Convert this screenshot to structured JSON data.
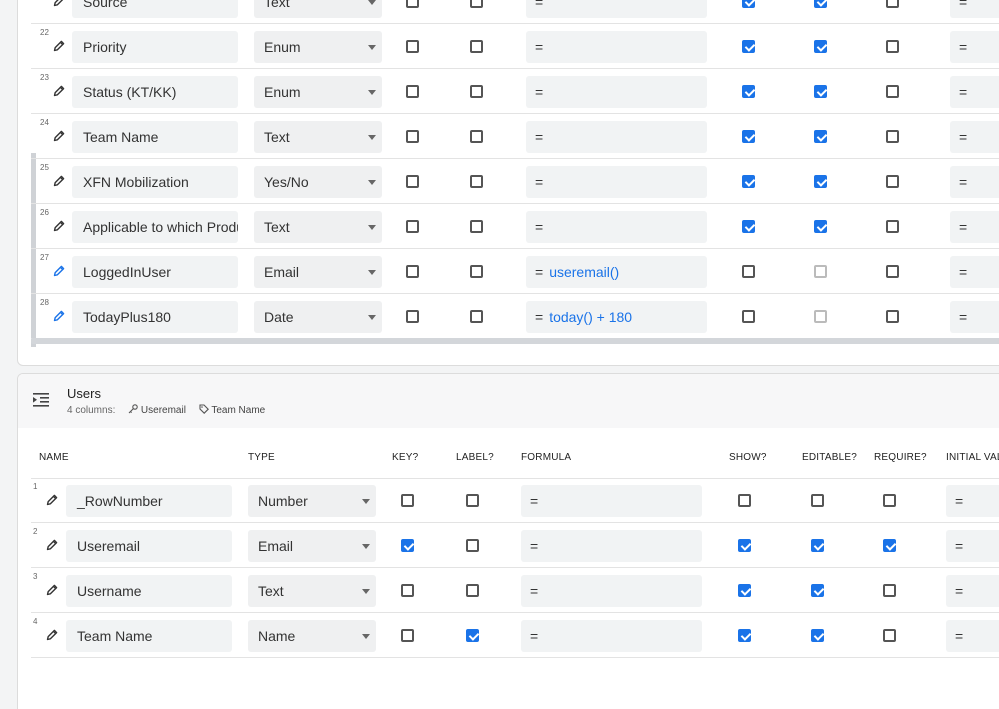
{
  "top_table": {
    "rows": [
      {
        "num": "",
        "name": "Source",
        "type": "Text",
        "key": false,
        "label": false,
        "formula_eq": "=",
        "formula": "",
        "show": true,
        "editable": true,
        "require": false,
        "init": "=",
        "pencil_color": "#333"
      },
      {
        "num": "22",
        "name": "Priority",
        "type": "Enum",
        "key": false,
        "label": false,
        "formula_eq": "=",
        "formula": "",
        "show": true,
        "editable": true,
        "require": false,
        "init": "=",
        "pencil_color": "#333"
      },
      {
        "num": "23",
        "name": "Status (KT/KK)",
        "type": "Enum",
        "key": false,
        "label": false,
        "formula_eq": "=",
        "formula": "",
        "show": true,
        "editable": true,
        "require": false,
        "init": "=",
        "pencil_color": "#333"
      },
      {
        "num": "24",
        "name": "Team Name",
        "type": "Text",
        "key": false,
        "label": false,
        "formula_eq": "=",
        "formula": "",
        "show": true,
        "editable": true,
        "require": false,
        "init": "=",
        "pencil_color": "#333"
      },
      {
        "num": "25",
        "name": "XFN Mobilization",
        "type": "Yes/No",
        "key": false,
        "label": false,
        "formula_eq": "=",
        "formula": "",
        "show": true,
        "editable": true,
        "require": false,
        "init": "=",
        "pencil_color": "#333"
      },
      {
        "num": "26",
        "name": "Applicable to which Produ",
        "type": "Text",
        "key": false,
        "label": false,
        "formula_eq": "=",
        "formula": "",
        "show": true,
        "editable": true,
        "require": false,
        "init": "=",
        "pencil_color": "#333"
      },
      {
        "num": "27",
        "name": "LoggedInUser",
        "type": "Email",
        "key": false,
        "label": false,
        "formula_eq": "=",
        "formula": "useremail()",
        "show": false,
        "editable": false,
        "editable_disabled": true,
        "require": false,
        "init": "=",
        "pencil_color": "#1a73e8"
      },
      {
        "num": "28",
        "name": "TodayPlus180",
        "type": "Date",
        "key": false,
        "label": false,
        "formula_eq": "=",
        "formula": "today() + 180",
        "show": false,
        "editable": false,
        "editable_disabled": true,
        "require": false,
        "init": "=",
        "pencil_color": "#1a73e8"
      }
    ]
  },
  "users_table": {
    "title": "Users",
    "columns_count": "4 columns:",
    "key_tag": "Useremail",
    "label_tag": "Team Name",
    "headers": {
      "name": "NAME",
      "type": "TYPE",
      "key": "KEY?",
      "label": "LABEL?",
      "formula": "FORMULA",
      "show": "SHOW?",
      "editable": "EDITABLE?",
      "require": "REQUIRE?",
      "initial": "INITIAL VAL"
    },
    "rows": [
      {
        "num": "1",
        "name": "_RowNumber",
        "type": "Number",
        "key": false,
        "label": false,
        "formula_eq": "=",
        "formula": "",
        "show": false,
        "editable": false,
        "require": false,
        "init": "="
      },
      {
        "num": "2",
        "name": "Useremail",
        "type": "Email",
        "key": true,
        "label": false,
        "formula_eq": "=",
        "formula": "",
        "show": true,
        "editable": true,
        "require": true,
        "init": "="
      },
      {
        "num": "3",
        "name": "Username",
        "type": "Text",
        "key": false,
        "label": false,
        "formula_eq": "=",
        "formula": "",
        "show": true,
        "editable": true,
        "require": false,
        "init": "="
      },
      {
        "num": "4",
        "name": "Team Name",
        "type": "Name",
        "key": false,
        "label": true,
        "formula_eq": "=",
        "formula": "",
        "show": true,
        "editable": true,
        "require": false,
        "init": "="
      }
    ]
  },
  "colors": {
    "accent": "#1a73e8",
    "checkbox_border": "#555555",
    "field_bg": "#f1f3f4"
  },
  "icons": {
    "edit": "pencil-icon",
    "table": "table-indent-icon",
    "key": "key-icon",
    "label": "tag-icon"
  }
}
